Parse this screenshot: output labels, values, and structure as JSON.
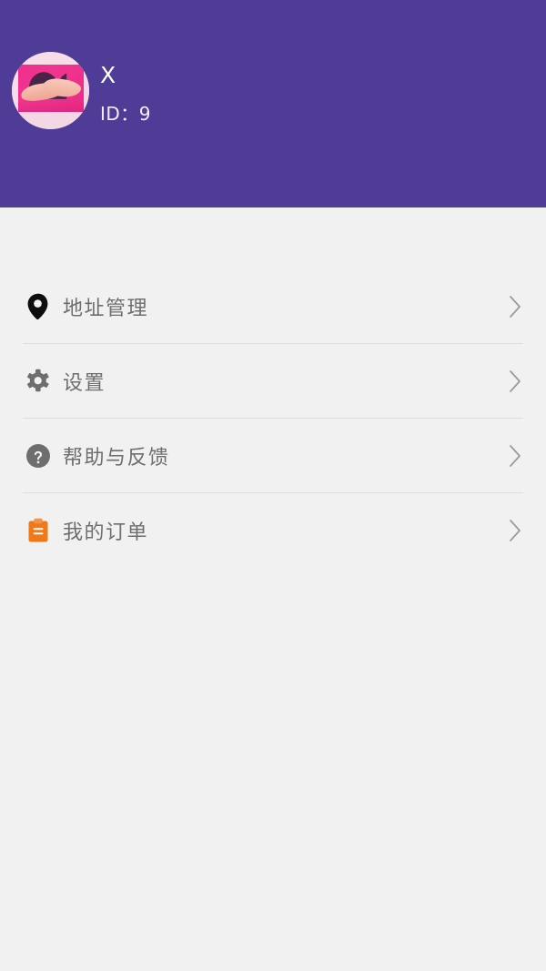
{
  "theme": {
    "header_bg": "#4e3c96",
    "page_bg": "#f2f1f1",
    "label_color": "#6e6e6e",
    "divider_color": "#e0dfdf",
    "order_icon_color": "#f07818",
    "help_icon_color": "#6e6e6e",
    "settings_icon_color": "#6e6e6e",
    "location_icon_color": "#0d0d0d"
  },
  "header": {
    "avatar_alt": "user-avatar-photo",
    "user_name": "X",
    "user_id": "ID：9"
  },
  "menu": {
    "items": [
      {
        "label": "地址管理",
        "icon": "location-pin-icon",
        "chevron": "chevron-right-icon"
      },
      {
        "label": "设置",
        "icon": "gear-icon",
        "chevron": "chevron-right-icon"
      },
      {
        "label": "帮助与反馈",
        "icon": "question-circle-icon",
        "chevron": "chevron-right-icon"
      },
      {
        "label": "我的订单",
        "icon": "clipboard-order-icon",
        "chevron": "chevron-right-icon"
      }
    ]
  }
}
